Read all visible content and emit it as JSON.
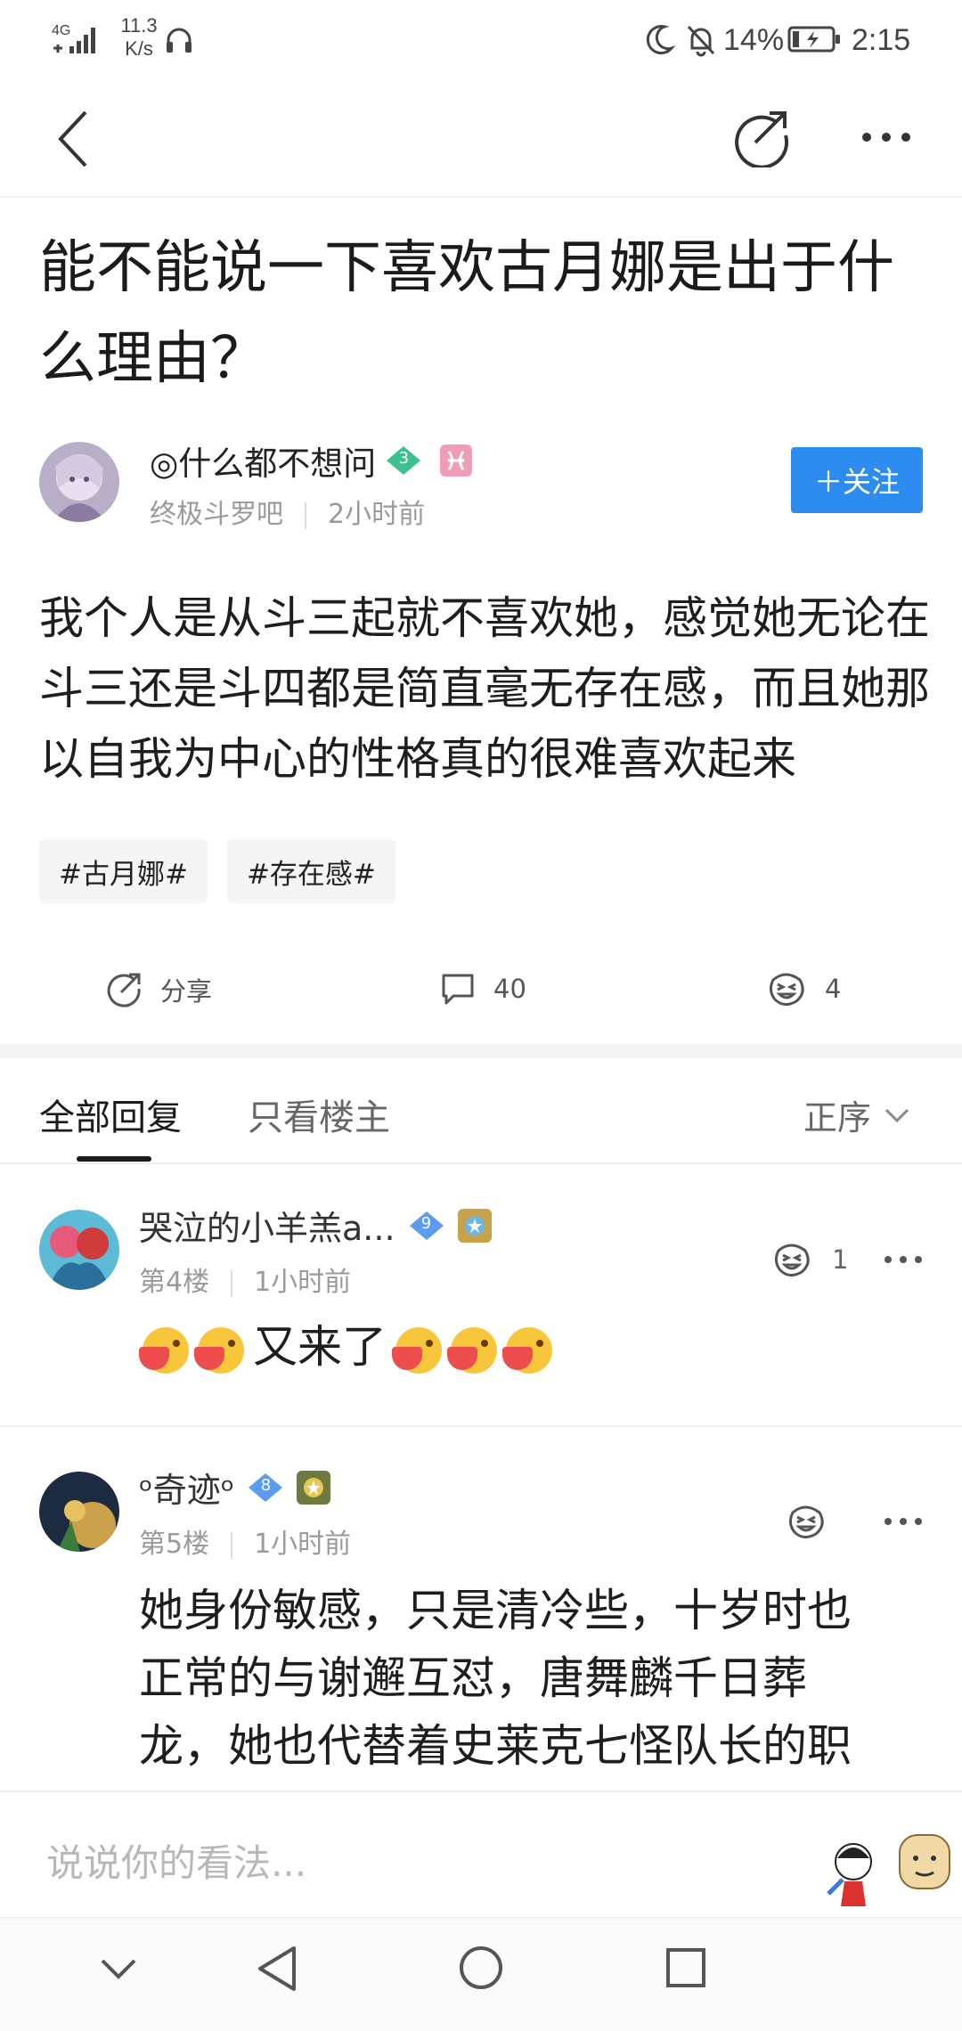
{
  "status_bar": {
    "network": "4G",
    "speed_value": "11.3",
    "speed_unit": "K/s",
    "battery": "14%",
    "time": "2:15"
  },
  "post": {
    "title": "能不能说一下喜欢古月娜是出于什么理由？",
    "author": {
      "name": "◎什么都不想问",
      "level": "3",
      "forum": "终极斗罗吧",
      "time": "2小时前"
    },
    "follow_label": "＋关注",
    "body": "我个人是从斗三起就不喜欢她，感觉她无论在斗三还是斗四都是简直毫无存在感，而且她那以自我为中心的性格真的很难喜欢起来",
    "tags": [
      "#古月娜#",
      "#存在感#"
    ],
    "actions": {
      "share_label": "分享",
      "comment_count": "40",
      "like_count": "4"
    }
  },
  "tabs": {
    "all": "全部回复",
    "op_only": "只看楼主",
    "sort": "正序"
  },
  "comments": [
    {
      "name": "哭泣的小羊羔a...",
      "level": "9",
      "floor": "第4楼",
      "time": "1小时前",
      "text": "又来了",
      "likes": "1"
    },
    {
      "name": "ᵒ奇迹ᵒ",
      "level": "8",
      "floor": "第5楼",
      "time": "1小时前",
      "text_lines": [
        "她身份敏感，只是清冷些，十岁时也",
        "正常的与谢邂互怼，唐舞麟千日葬",
        "龙，她也代替着史莱克七怪队长的职"
      ],
      "likes": ""
    }
  ],
  "input": {
    "placeholder": "说说你的看法..."
  },
  "colors": {
    "accent": "#2d8cf0",
    "level_green": "#3dbf8f",
    "level_blue": "#5b9cf0"
  }
}
